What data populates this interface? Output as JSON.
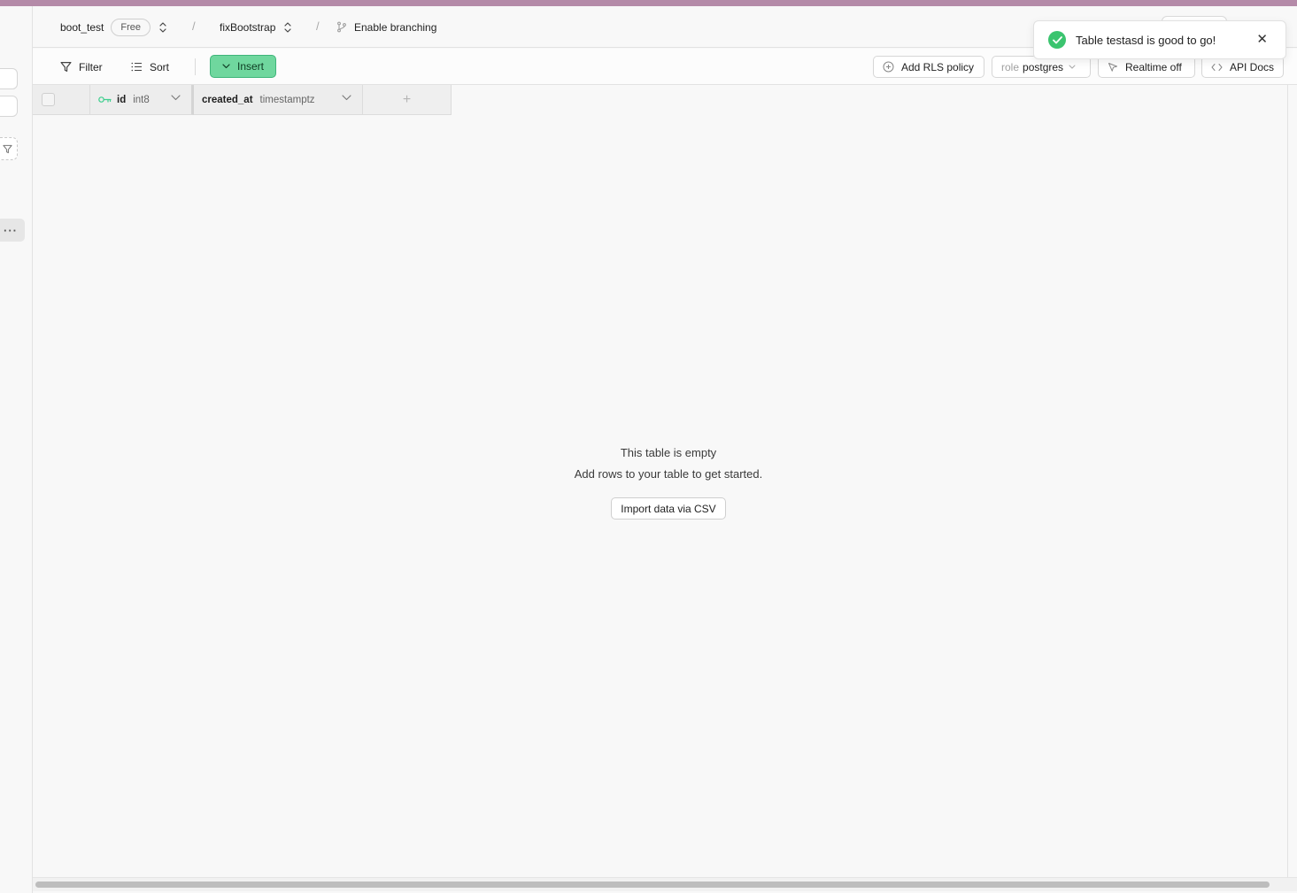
{
  "header": {
    "project_name": "boot_test",
    "plan_badge": "Free",
    "branch_name": "fixBootstrap",
    "separator": "/",
    "enable_branching_label": "Enable branching"
  },
  "toolbar": {
    "filter_label": "Filter",
    "sort_label": "Sort",
    "insert_label": "Insert",
    "add_rls_label": "Add RLS policy",
    "role_prefix": "role",
    "role_value": "postgres",
    "realtime_label": "Realtime off",
    "api_docs_label": "API Docs"
  },
  "grid": {
    "columns": [
      {
        "name": "id",
        "type": "int8",
        "primary_key": true
      },
      {
        "name": "created_at",
        "type": "timestamptz",
        "primary_key": false
      }
    ],
    "add_column_label": "+"
  },
  "empty_state": {
    "title": "This table is empty",
    "subtitle": "Add rows to your table to get started.",
    "import_button": "Import data via CSV"
  },
  "toast": {
    "message": "Table testasd is good to go!",
    "close_glyph": "✕"
  },
  "sidebar": {
    "more_glyph": "···"
  },
  "colors": {
    "accent_green": "#3ecf8e",
    "insert_bg": "#6fd79e",
    "success": "#3bc46f",
    "top_strip": "#b48aa8"
  }
}
